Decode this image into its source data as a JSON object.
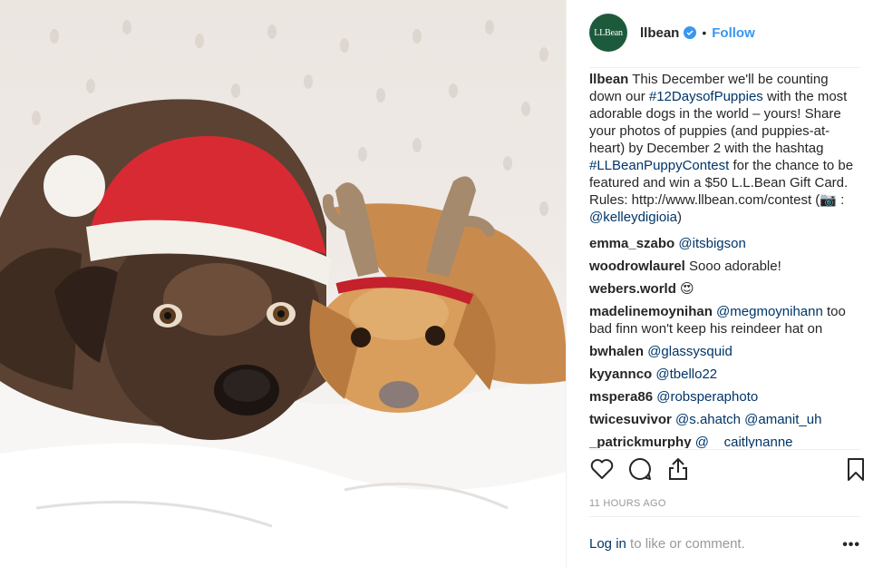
{
  "header": {
    "avatar_text": "LLBean",
    "username": "llbean",
    "separator": "•",
    "follow_label": "Follow"
  },
  "caption": {
    "username": "llbean",
    "text_1": "This December we'll be counting down our ",
    "hashtag_1": "#12DaysofPuppies",
    "text_2": " with the most adorable dogs in the world – yours! Share your photos of puppies (and puppies-at-heart) by December 2 with the hashtag ",
    "hashtag_2": "#LLBeanPuppyContest",
    "text_3": " for the chance to be featured and win a $50 L.L.Bean Gift Card. Rules: http://www.llbean.com/contest (📷 : ",
    "mention": "@kelleydigioia",
    "text_4": ")"
  },
  "comments": [
    {
      "username": "emma_szabo",
      "mention": "@itsbigson",
      "text": ""
    },
    {
      "username": "woodrowlaurel",
      "mention": "",
      "text": "Sooo adorable!"
    },
    {
      "username": "webers.world",
      "mention": "",
      "text": "😍"
    },
    {
      "username": "madelinemoynihan",
      "mention": "@megmoynihann",
      "text": " too bad finn won't keep his reindeer hat on"
    },
    {
      "username": "bwhalen",
      "mention": "@glassysquid",
      "text": ""
    },
    {
      "username": "kyyannco",
      "mention": "@tbello22",
      "text": ""
    },
    {
      "username": "mspera86",
      "mention": "@robsperaphoto",
      "text": ""
    },
    {
      "username": "twicesuvivor",
      "mention": "@s.ahatch @amanit_uh",
      "text": ""
    },
    {
      "username": "_patrickmurphy",
      "mention": "@__caitlynanne",
      "text": ""
    }
  ],
  "actions": {
    "like_icon": "heart-icon",
    "comment_icon": "speech-bubble-icon",
    "share_icon": "share-icon",
    "save_icon": "bookmark-icon"
  },
  "timestamp": "11 HOURS AGO",
  "footer": {
    "login_link": "Log in",
    "login_text": " to like or comment.",
    "more_label": "•••"
  },
  "colors": {
    "link": "#3897f0",
    "hashtag": "#003569",
    "avatar_bg": "#1d5a3c",
    "muted": "#999999"
  }
}
